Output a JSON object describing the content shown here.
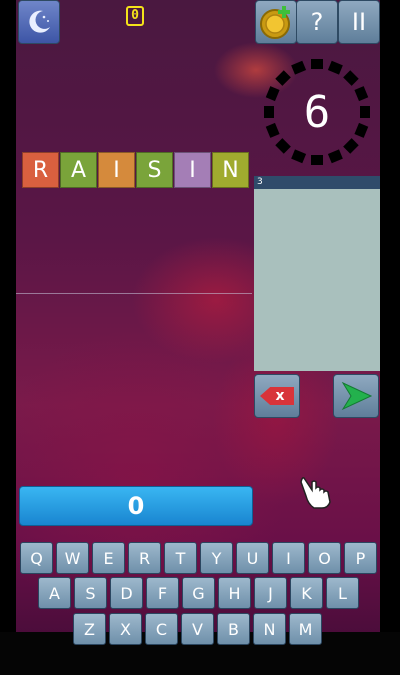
{
  "top_bar": {
    "theme_icon": "crescent-moon-icon",
    "counter_badge": "0",
    "coin_icon": "coin-plus-icon",
    "help_label": "?",
    "pause_label": "II"
  },
  "timer": {
    "value": "6",
    "dial_icon": "segmented-ring-icon"
  },
  "found_words_panel": {
    "header": "3"
  },
  "word_tiles": [
    {
      "letter": "R",
      "color": "#d9603f"
    },
    {
      "letter": "A",
      "color": "#7aa43a"
    },
    {
      "letter": "I",
      "color": "#d58a3c"
    },
    {
      "letter": "S",
      "color": "#7aa43a"
    },
    {
      "letter": "I",
      "color": "#a47eb6"
    },
    {
      "letter": "N",
      "color": "#a0ab2f"
    }
  ],
  "actions": {
    "delete_label": "x",
    "submit_icon": "play-arrow-icon",
    "hand_icon": "pointing-hand-icon"
  },
  "score": {
    "value": "0"
  },
  "keyboard": {
    "row1": [
      "Q",
      "W",
      "E",
      "R",
      "T",
      "Y",
      "U",
      "I",
      "O",
      "P"
    ],
    "row2": [
      "A",
      "S",
      "D",
      "F",
      "G",
      "H",
      "J",
      "K",
      "L"
    ],
    "row3": [
      "Z",
      "X",
      "C",
      "V",
      "B",
      "N",
      "M"
    ]
  },
  "colors": {
    "accent_blue": "#1e8fd8",
    "delete_red": "#d8343a",
    "submit_green": "#23b14d",
    "badge_yellow": "#f4e21a"
  }
}
